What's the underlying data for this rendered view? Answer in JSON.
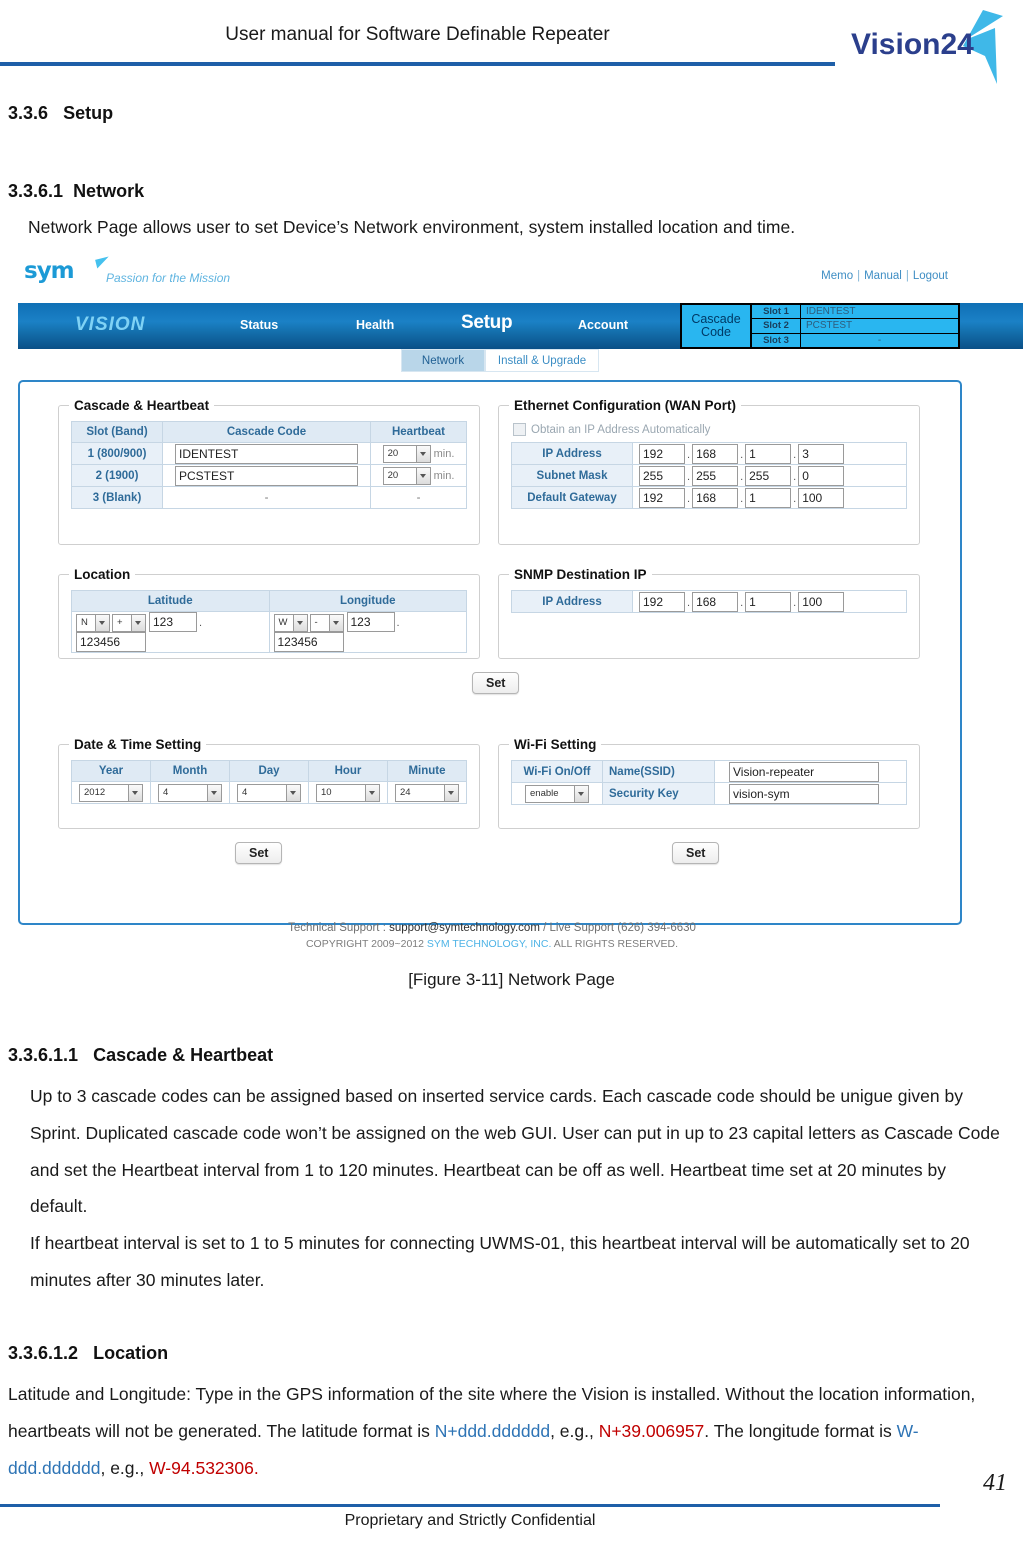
{
  "document": {
    "header_title": "User manual for Software Definable Repeater",
    "brand": "Vision24",
    "footer_text": "Proprietary and Strictly Confidential",
    "page_number": "41"
  },
  "sections": {
    "s356_num": "3.3.6",
    "s356_title": "Setup",
    "s3561_num": "3.3.6.1",
    "s3561_title": "Network",
    "s3561_intro": "Network Page allows user to set Device’s Network environment, system installed location and time.",
    "figure_caption": "[Figure 3-11] Network Page",
    "s35611_num": "3.3.6.1.1",
    "s35611_title": "Cascade & Heartbeat",
    "s35611_p1": "Up to 3 cascade codes can be assigned based on inserted service cards.    Each cascade code should be unigue given by Sprint. Duplicated cascade code won’t be assigned on the web GUI. User can put in up to 23 capital letters as Cascade Code and set the Heartbeat interval from 1 to 120 minutes. Heartbeat can be off as well. Heartbeat time set at 20 minutes by default.",
    "s35611_p2": "If heartbeat interval is set to 1 to 5 minutes for connecting UWMS-01, this heartbeat interval will be automatically set to 20 minutes after 30 minutes later.",
    "s35612_num": "3.3.6.1.2",
    "s35612_title": "Location",
    "s35612_p1a": "Latitude and Longitude: Type in the GPS information of the site where the Vision is installed. Without the location information, heartbeats will not be generated.    The latitude format is ",
    "s35612_fmt_lat": "N+ddd.dddddd",
    "s35612_p1b": ", e.g., ",
    "s35612_ex_lat": "N+39.006957",
    "s35612_p1c": ".    The longitude format is ",
    "s35612_fmt_lon": "W-ddd.dddddd",
    "s35612_p1d": ", e.g., ",
    "s35612_ex_lon": "W-94.532306."
  },
  "webui": {
    "logo_word": "sym",
    "logo_tagline": "Passion for the Mission",
    "top_links": [
      "Memo",
      "Manual",
      "Logout"
    ],
    "top_links_separator": "|",
    "nav": {
      "brand": "VISION",
      "items": [
        "Status",
        "Health",
        "Setup",
        "Account"
      ],
      "active": "Setup"
    },
    "cascade_header": {
      "label_line1": "Cascade",
      "label_line2": "Code",
      "rows": [
        {
          "slot": "Slot 1",
          "value": "IDENTEST"
        },
        {
          "slot": "Slot 2",
          "value": "PCSTEST"
        },
        {
          "slot": "Slot 3",
          "value": "-"
        }
      ]
    },
    "subtabs": [
      {
        "label": "Network",
        "active": true
      },
      {
        "label": "Install & Upgrade",
        "active": false
      }
    ],
    "cascade_heartbeat": {
      "legend": "Cascade & Heartbeat",
      "columns": [
        "Slot (Band)",
        "Cascade Code",
        "Heartbeat"
      ],
      "rows": [
        {
          "slot": "1 (800/900)",
          "code": "IDENTEST",
          "heartbeat": "20",
          "unit": "min."
        },
        {
          "slot": "2 (1900)",
          "code": "PCSTEST",
          "heartbeat": "20",
          "unit": "min."
        },
        {
          "slot": "3 (Blank)",
          "code": "-",
          "heartbeat": "-",
          "unit": ""
        }
      ]
    },
    "ethernet": {
      "legend": "Ethernet Configuration (WAN Port)",
      "checkbox_label": "Obtain an IP Address Automatically",
      "checkbox_checked": false,
      "rows": [
        {
          "label": "IP Address",
          "o1": "192",
          "o2": "168",
          "o3": "1",
          "o4": "3"
        },
        {
          "label": "Subnet Mask",
          "o1": "255",
          "o2": "255",
          "o3": "255",
          "o4": "0"
        },
        {
          "label": "Default Gateway",
          "o1": "192",
          "o2": "168",
          "o3": "1",
          "o4": "100"
        }
      ]
    },
    "location": {
      "legend": "Location",
      "columns": [
        "Latitude",
        "Longitude"
      ],
      "latitude": {
        "hemisphere": "N",
        "sign": "+",
        "degrees": "123",
        "decimals": "123456"
      },
      "longitude": {
        "hemisphere": "W",
        "sign": "-",
        "degrees": "123",
        "decimals": "123456"
      }
    },
    "snmp": {
      "legend": "SNMP Destination IP",
      "label": "IP Address",
      "o1": "192",
      "o2": "168",
      "o3": "1",
      "o4": "100"
    },
    "datetime": {
      "legend": "Date & Time Setting",
      "columns": [
        "Year",
        "Month",
        "Day",
        "Hour",
        "Minute"
      ],
      "values": [
        "2012",
        "4",
        "4",
        "10",
        "24"
      ]
    },
    "wifi": {
      "legend": "Wi-Fi Setting",
      "onoff_label": "Wi-Fi On/Off",
      "onoff_value": "enable",
      "ssid_label": "Name(SSID)",
      "ssid_value": "Vision-repeater",
      "key_label": "Security Key",
      "key_value": "vision-sym"
    },
    "buttons": {
      "set": "Set"
    },
    "footer": {
      "support_prefix": "Technical Support : ",
      "support_email": "support@symtechnology.com",
      "support_suffix": " / Live Support (626) 394-6630",
      "copyright_prefix": "COPYRIGHT 2009~2012 ",
      "copyright_company": "SYM TECHNOLOGY, INC.",
      "copyright_suffix": " ALL RIGHTS RESERVED."
    }
  }
}
